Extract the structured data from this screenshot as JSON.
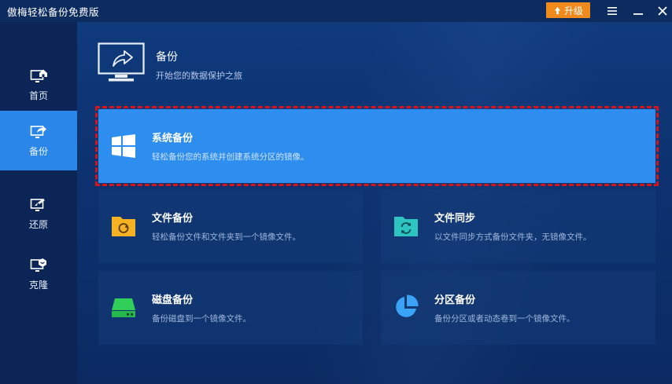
{
  "window": {
    "title": "傲梅轻松备份免费版",
    "upgrade_label": "升级"
  },
  "sidebar": {
    "items": [
      {
        "label": "首页",
        "icon": "home-icon"
      },
      {
        "label": "备份",
        "icon": "backup-icon",
        "active": true
      },
      {
        "label": "还原",
        "icon": "restore-icon"
      },
      {
        "label": "克隆",
        "icon": "clone-icon"
      }
    ]
  },
  "header": {
    "title": "备份",
    "subtitle": "开始您的数据保护之旅"
  },
  "cards": {
    "system": {
      "title": "系统备份",
      "desc": "轻松备份您的系统并创建系统分区的镜像。",
      "icon": "windows-icon"
    },
    "file": {
      "title": "文件备份",
      "desc": "轻松备份文件和文件夹到一个镜像文件。",
      "icon": "folder-backup-icon"
    },
    "sync": {
      "title": "文件同步",
      "desc": "以文件同步方式备份文件夹，无镜像文件。",
      "icon": "folder-sync-icon"
    },
    "disk": {
      "title": "磁盘备份",
      "desc": "备份磁盘到一个镜像文件。",
      "icon": "disk-icon"
    },
    "partition": {
      "title": "分区备份",
      "desc": "备份分区或者动态卷到一个镜像文件。",
      "icon": "pie-chart-icon"
    }
  },
  "colors": {
    "accent": "#2d8ef0",
    "upgrade": "#f08a1c",
    "highlight_border": "#d4161c"
  }
}
